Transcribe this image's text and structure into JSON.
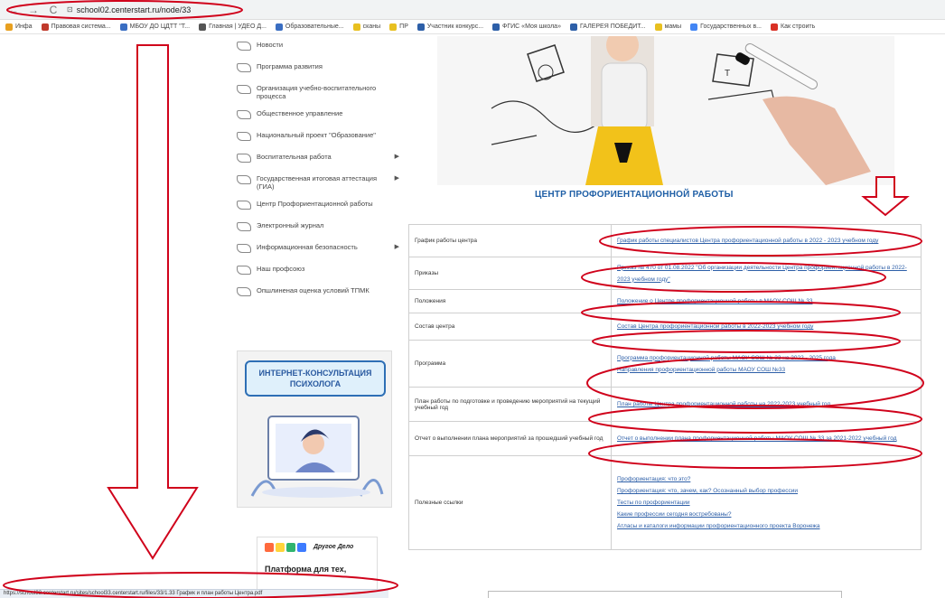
{
  "browser": {
    "url": "school02.centerstart.ru/node/33",
    "nav_back": "←",
    "nav_forward": "→",
    "nav_reload": "C",
    "lock": "⊡"
  },
  "bookmarks": [
    {
      "label": "Инфа",
      "color": "#e8a020"
    },
    {
      "label": "Правовая система...",
      "color": "#c0392b"
    },
    {
      "label": "МБОУ ДО ЦДТТ \"Т...",
      "color": "#3a6ec2"
    },
    {
      "label": "Главная | УДЕО Д...",
      "color": "#555555"
    },
    {
      "label": "Образовательные...",
      "color": "#3a6ec2"
    },
    {
      "label": "сканы",
      "color": "#e8c020"
    },
    {
      "label": "ПР",
      "color": "#e8c020"
    },
    {
      "label": "Участник конкурс...",
      "color": "#2d5fa8"
    },
    {
      "label": "ФГИС «Моя школа»",
      "color": "#2d5fa8"
    },
    {
      "label": "ГАЛЕРЕЯ ПОБЕДИТ...",
      "color": "#2d5fa8"
    },
    {
      "label": "мамы",
      "color": "#e8c020"
    },
    {
      "label": "Государственных в...",
      "color": "#4285f4"
    },
    {
      "label": "Как строить",
      "color": "#d93025"
    }
  ],
  "sidebar": {
    "items": [
      {
        "label": "Новости",
        "arrow": ""
      },
      {
        "label": "Программа развития",
        "arrow": ""
      },
      {
        "label": "Организация учебно-воспитательного процесса",
        "arrow": ""
      },
      {
        "label": "Общественное управление",
        "arrow": ""
      },
      {
        "label": "Национальный проект \"Образование\"",
        "arrow": ""
      },
      {
        "label": "Воспитательная работа",
        "arrow": "▶"
      },
      {
        "label": "Государственная итоговая аттестация (ГИА)",
        "arrow": "▶"
      },
      {
        "label": "Центр Профориентационной работы",
        "arrow": ""
      },
      {
        "label": "Электронный журнал",
        "arrow": ""
      },
      {
        "label": "Информационная безопасность",
        "arrow": "▶"
      },
      {
        "label": "Наш профсоюз",
        "arrow": ""
      },
      {
        "label": "Опшлиненая оценка условий ТПМК",
        "arrow": ""
      }
    ]
  },
  "banner_psy": {
    "title": "ИНТЕРНЕТ-КОНСУЛЬТАЦИЯ ПСИХОЛОГА"
  },
  "banner_drugie": {
    "name": "Другое Дело",
    "sub": "Платформа для тех,"
  },
  "section": {
    "title": "ЦЕНТР ПРОФОРИЕНТАЦИОННОЙ РАБОТЫ"
  },
  "table": {
    "rows": [
      {
        "label": "График работы центра",
        "links": [
          "График работы специалистов Центра профориентационной работы в 2022 - 2023 учебном году"
        ]
      },
      {
        "label": "Приказы",
        "links": [
          "Приказ № 470 от 01.08.2022 \"Об организации деятельности Центра профориентационной работы в 2022-2023 учебном году\""
        ]
      },
      {
        "label": "Положения",
        "links": [
          "Положение о Центре профориентационной работы в МАОУ СОШ № 33"
        ]
      },
      {
        "label": "Состав центра",
        "links": [
          "Состав Центра профориентационной работы в 2022-2023 учебном году"
        ]
      },
      {
        "label": "Программа",
        "links": [
          "Программа профориентационной работы МАОУ СОШ № 33 на 2022 - 2025 года",
          "Направления профориентационной работы МАОУ СОШ №33"
        ]
      },
      {
        "label": "План работы по подготовке и проведению мероприятий на текущий учебный год",
        "links": [
          "План работы Центра профориентационной работы на 2022-2023 учебный год"
        ]
      },
      {
        "label": "Отчет о выполнении плана мероприятий за прошедший учебный год",
        "links": [
          "Отчет о выполнении плана профориентационной работы МАОУ СОШ № 33 за 2021-2022 учебный год"
        ]
      },
      {
        "label": "Полезные ссылки",
        "links": [
          "Профориентация: что это?",
          "Профориентация: что, зачем, как? Осознанный выбор профессии",
          "Тесты по профориентации",
          "Какие профессии сегодня востребованы?",
          "Атласы и каталоги информации профориентационного проекта Воронежа"
        ]
      }
    ]
  },
  "statusbar": {
    "text": "https://school33.centerstart.ru/sites/school33.centerstart.ru/files/33/1.33 График и план работы Центра.pdf"
  },
  "colors": {
    "annotation": "#d0021b",
    "link": "#2d5fa8",
    "title": "#1f5fa6"
  }
}
